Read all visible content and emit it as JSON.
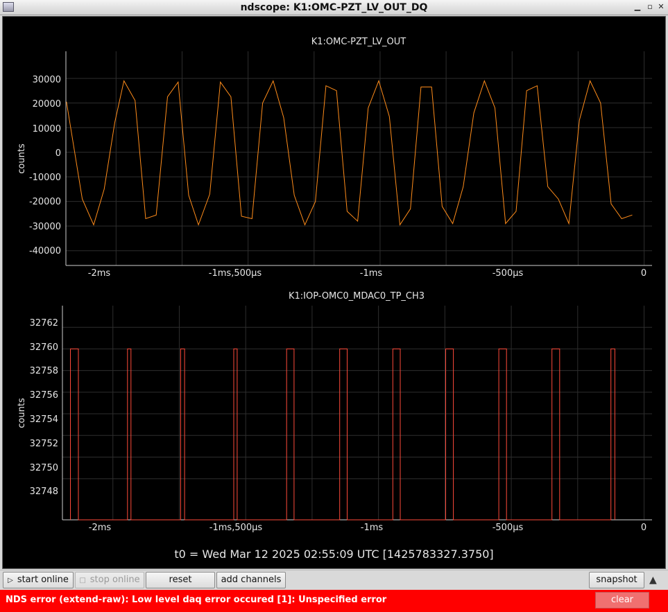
{
  "window": {
    "title": "ndscope: K1:OMC-PZT_LV_OUT_DQ"
  },
  "plots": [
    {
      "title": "K1:OMC-PZT_LV_OUT",
      "ylabel": "counts",
      "ytick_labels": [
        "30000",
        "20000",
        "10000",
        "0",
        "-10000",
        "-20000",
        "-30000",
        "-40000"
      ],
      "xtick_labels": [
        "-2ms",
        "-1ms,500µs",
        "-1ms",
        "-500µs",
        "0"
      ],
      "color": "#ff8c1a"
    },
    {
      "title": "K1:IOP-OMC0_MDAC0_TP_CH3",
      "ylabel": "counts",
      "ytick_labels": [
        "32762",
        "32760",
        "32758",
        "32756",
        "32754",
        "32752",
        "32750",
        "32748"
      ],
      "xtick_labels": [
        "-2ms",
        "-1ms,500µs",
        "-1ms",
        "-500µs",
        "0"
      ],
      "color": "#ff4a3a"
    }
  ],
  "chart_data": [
    {
      "type": "line",
      "title": "K1:OMC-PZT_LV_OUT",
      "xlabel": "",
      "ylabel": "counts",
      "xlim": [
        -2.19,
        0.03
      ],
      "ylim": [
        -46000,
        41000
      ],
      "x_unit": "ms",
      "grid": true,
      "series": [
        {
          "x": [
            -2.188,
            -2.128,
            -2.085,
            -2.045,
            -2.005,
            -1.97,
            -1.928,
            -1.888,
            -1.848,
            -1.805,
            -1.765,
            -1.725,
            -1.688,
            -1.645,
            -1.605,
            -1.565,
            -1.525,
            -1.485,
            -1.445,
            -1.405,
            -1.365,
            -1.325,
            -1.285,
            -1.245,
            -1.205,
            -1.165,
            -1.125,
            -1.085,
            -1.045,
            -1.005,
            -0.965,
            -0.925,
            -0.885,
            -0.845,
            -0.805,
            -0.765,
            -0.725,
            -0.685,
            -0.645,
            -0.605,
            -0.565,
            -0.525,
            -0.485,
            -0.445,
            -0.405,
            -0.365,
            -0.325,
            -0.285,
            -0.245,
            -0.205,
            -0.165,
            -0.125,
            -0.085,
            -0.045
          ],
          "y": [
            20500,
            -19000,
            -29500,
            -15000,
            12000,
            29000,
            21000,
            -27000,
            -25500,
            22500,
            28500,
            -17500,
            -29500,
            -17000,
            28500,
            22500,
            -26000,
            -27000,
            20000,
            29000,
            14000,
            -17500,
            -29500,
            -20000,
            27000,
            25000,
            -24000,
            -28000,
            18000,
            29000,
            14500,
            -29500,
            -23000,
            26500,
            26500,
            -22000,
            -29000,
            -14000,
            16000,
            29000,
            18000,
            -29000,
            -24000,
            25000,
            27000,
            -14000,
            -19000,
            -29000,
            13000,
            29000,
            20000,
            -21000,
            -27000,
            -25500
          ]
        }
      ]
    },
    {
      "type": "line",
      "title": "K1:IOP-OMC0_MDAC0_TP_CH3",
      "xlabel": "",
      "ylabel": "counts",
      "xlim": [
        -2.19,
        0.03
      ],
      "ylim": [
        32744.2,
        32764.0
      ],
      "x_unit": "ms",
      "grid": true,
      "series": [
        {
          "x": [
            -2.16,
            -2.16,
            -2.13,
            -2.13,
            -1.945,
            -1.945,
            -1.932,
            -1.932,
            -1.745,
            -1.745,
            -1.73,
            -1.73,
            -1.545,
            -1.545,
            -1.532,
            -1.532,
            -1.346,
            -1.346,
            -1.318,
            -1.318,
            -1.146,
            -1.146,
            -1.118,
            -1.118,
            -0.946,
            -0.946,
            -0.918,
            -0.918,
            -0.747,
            -0.747,
            -0.718,
            -0.718,
            -0.547,
            -0.547,
            -0.518,
            -0.518,
            -0.347,
            -0.347,
            -0.318,
            -0.318,
            -0.125,
            -0.125,
            -0.11,
            -0.11
          ],
          "y": [
            32744.2,
            32760,
            32760,
            32744.2,
            32744.2,
            32760,
            32760,
            32744.2,
            32744.2,
            32760,
            32760,
            32744.2,
            32744.2,
            32760,
            32760,
            32744.2,
            32744.2,
            32760,
            32760,
            32744.2,
            32744.2,
            32760,
            32760,
            32744.2,
            32744.2,
            32760,
            32760,
            32744.2,
            32744.2,
            32760,
            32760,
            32744.2,
            32744.2,
            32760,
            32760,
            32744.2,
            32744.2,
            32760,
            32760,
            32744.2,
            32744.2,
            32760,
            32760,
            32744.2
          ]
        }
      ]
    }
  ],
  "t0": "t0 = Wed Mar 12 2025 02:55:09 UTC [1425783327.3750]",
  "toolbar": {
    "start_online": "start online",
    "stop_online": "stop online",
    "reset": "reset",
    "add_channels": "add channels",
    "snapshot": "snapshot"
  },
  "error": {
    "message": "NDS error (extend-raw): Low level daq error occured [1]: Unspecified error",
    "clear": "clear"
  }
}
